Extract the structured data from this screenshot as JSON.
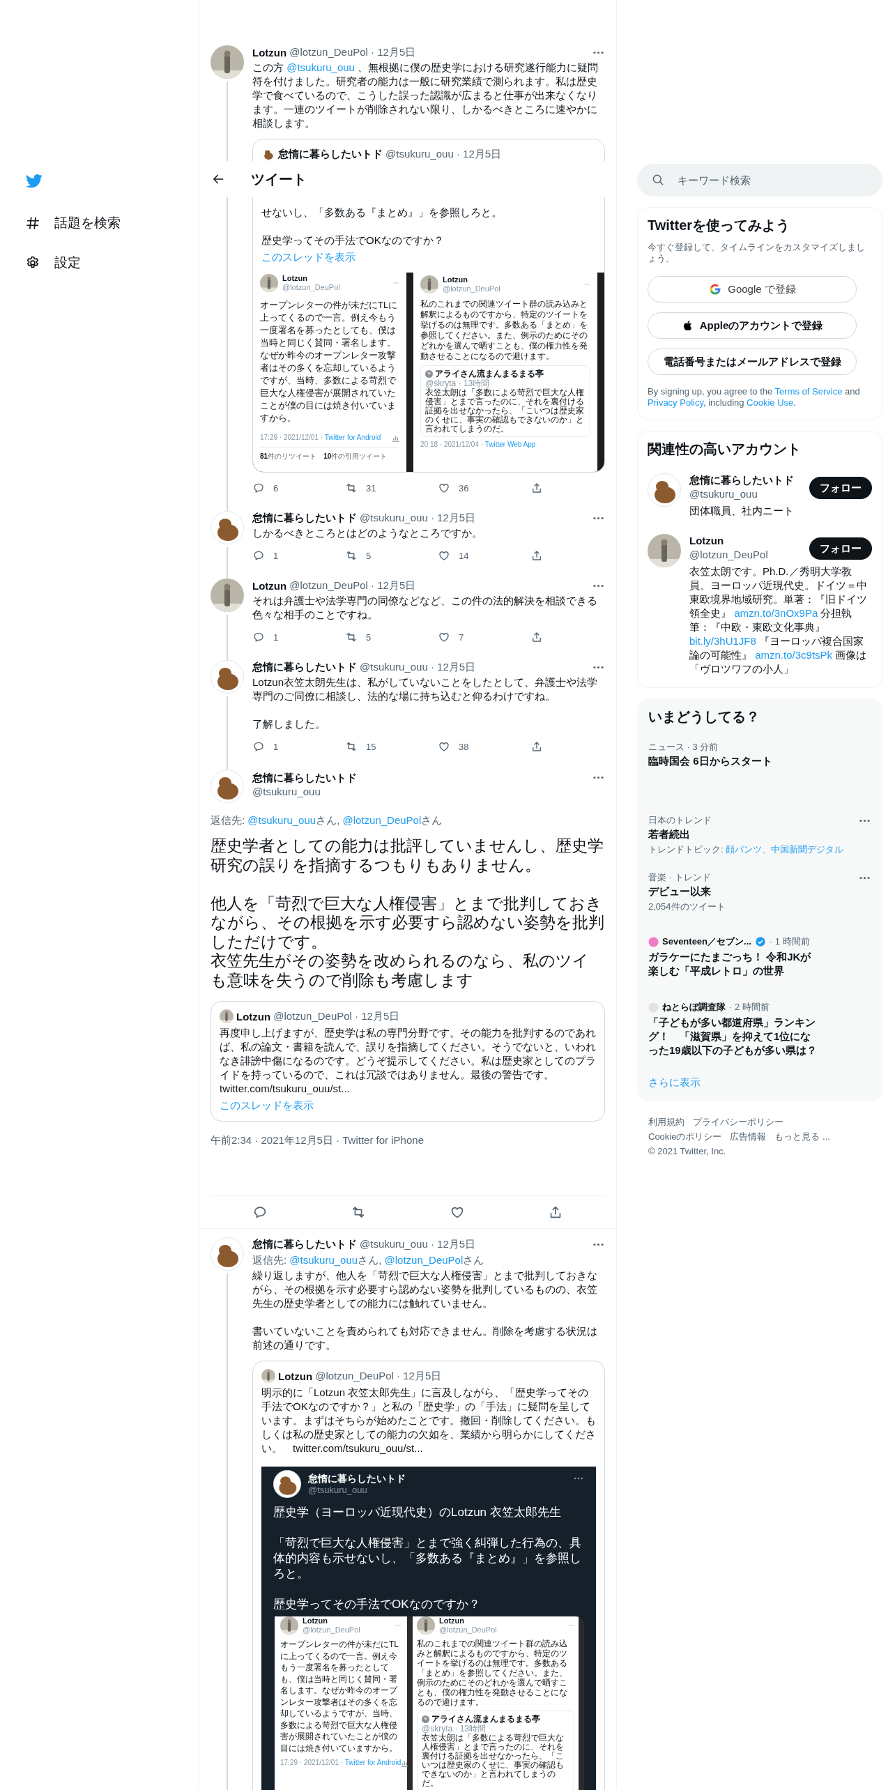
{
  "nav": {
    "items": [
      {
        "kind": "explore",
        "label": "話題を検索"
      },
      {
        "kind": "settings",
        "label": "設定"
      }
    ]
  },
  "header": {
    "title": "ツイート"
  },
  "thread": [
    {
      "avatar": {
        "kind": "statue"
      },
      "name": "Lotzun",
      "meta": "@lotzun_DeuPol · 12月5日",
      "connected": true,
      "text": [
        {
          "kind": "text",
          "t": "この方 "
        },
        {
          "kind": "link",
          "t": "@tsukuru_ouu"
        },
        {
          "kind": "text",
          "t": " 、無根拠に僕の歴史学における研究遂行能力に疑問符を付けました。研究者の能力は一般に研究業績で測られます。私は歴史学で食べているので、こうした誤った認識が広まると仕事が出来なくなります。一連のツイートが削除されない限り、しかるべきところに速やかに相談します。"
        }
      ],
      "quote": {
        "avatar": {
          "kind": "sealion"
        },
        "name": "怠惰に暮らしたいトド",
        "meta": "@tsukuru_ouu · 12月5日",
        "paragraphs": [
          [
            "せないし、「多数ある『まとめ』」を参照しろと。"
          ],
          [
            "歴史学ってその手法でOKなのですか？"
          ]
        ],
        "thread_link": "このスレッドを表示",
        "image": {
          "kind": "panels",
          "panels": [
            {
              "avatar": {
                "kind": "statue"
              },
              "name": "Lotzun",
              "handle": "@lotzun_DeuPol",
              "text": "オープンレターの件が未だにTLに上ってくるので一言。例え今もう一度署名を募ったとしても、僕は当時と同じく賛同・署名します。なぜか昨今のオープンレター攻撃者はその多くを忘却しているようですが、当時、多数による苛烈で巨大な人権侵害が展開されていたことが僕の目には焼き付いていますから。",
              "time": "17:29 · 2021/12/01 · ",
              "app": "Twitter for Android",
              "counts": [
                "**81**件のリツイート",
                "**10**件の引用ツイート"
              ]
            },
            {
              "avatar": {
                "kind": "statue"
              },
              "name": "Lotzun",
              "handle": "@lotzun_DeuPol",
              "text": "私のこれまでの関連ツイート群の読み込みと解釈によるものですから、特定のツイートを挙げるのは無理です。多数ある「まとめ」を参照してください。また、例示のためにそのどれかを選んで晒すことも、僕の権力性を発動させることになるので避けます。",
              "quote": {
                "avatar": {
                  "kind": "plain"
                },
                "name": "アライさん流まんまるまる亭",
                "meta": "@skryta · 13時間",
                "text": "衣笠太朗は「多数による苛烈で巨大な人権侵害」とまで言ったのに、それを裏付ける証拠を出せなかったら、「こいつは歴史家のくせに、事実の確認もできないのか」と言われてしまうのだ。"
              },
              "time": "20:18 · 2021/12/04 · ",
              "app": "Twitter Web App"
            }
          ]
        }
      },
      "stats": {
        "replies": "6",
        "retweets": "31",
        "likes": "36"
      }
    },
    {
      "avatar": {
        "kind": "sealion"
      },
      "name": "怠惰に暮らしたいトド",
      "meta": "@tsukuru_ouu · 12月5日",
      "connected": true,
      "text": "しかるべきところとはどのようなところですか。",
      "stats": {
        "replies": "1",
        "retweets": "5",
        "likes": "14"
      }
    },
    {
      "avatar": {
        "kind": "statue"
      },
      "name": "Lotzun",
      "meta": "@lotzun_DeuPol · 12月5日",
      "connected": true,
      "text": "それは弁護士や法学専門の同僚などなど、この件の法的解決を相談できる色々な相手のことですね。",
      "stats": {
        "replies": "1",
        "retweets": "5",
        "likes": "7"
      }
    },
    {
      "avatar": {
        "kind": "sealion"
      },
      "name": "怠惰に暮らしたいトド",
      "meta": "@tsukuru_ouu · 12月5日",
      "connected": true,
      "paragraphs": [
        [
          "Lotzun衣笠太朗先生は、私がしていないことをしたとして、弁護士や法学専門のご同僚に相談し、法的な場に持ち込むと仰るわけですね。"
        ],
        [
          "了解しました。"
        ]
      ],
      "stats": {
        "replies": "1",
        "retweets": "15",
        "likes": "38"
      }
    }
  ],
  "focus": {
    "avatar": {
      "kind": "sealion"
    },
    "name": "怠惰に暮らしたいトド",
    "handle": "@tsukuru_ouu",
    "reply_to": [
      {
        "kind": "text",
        "t": "返信先: "
      },
      {
        "kind": "link",
        "t": "@tsukuru_ouu"
      },
      {
        "kind": "text",
        "t": "さん, "
      },
      {
        "kind": "link",
        "t": "@lotzun_DeuPol"
      },
      {
        "kind": "text",
        "t": "さん"
      }
    ],
    "paragraphs": [
      [
        "歴史学者としての能力は批評していませんし、歴史学研究の誤りを指摘するつもりもありません。"
      ],
      [
        "他人を「苛烈で巨大な人権侵害」とまで批判しておきながら、その根拠を示す必要すら認めない姿勢を批判しただけです。",
        "衣笠先生がその姿勢を改められるのなら、私のツイも意味を失うので削除も考慮します"
      ]
    ],
    "quote": {
      "avatar": {
        "kind": "statue"
      },
      "name": "Lotzun",
      "meta": "@lotzun_DeuPol · 12月5日",
      "paragraphs": [
        [
          "再度申し上げますが、歴史学は私の専門分野です。その能力を批判するのであれば、私の論文・書籍を読んで、誤りを指摘してください。そうでないと、いわれなき誹謗中傷になるのです。どうぞ提示してください。私は歴史家としてのプライドを持っているので、これは冗談ではありません。最後の警告です。",
          "twitter.com/tsukuru_ouu/st..."
        ]
      ],
      "thread_link": "このスレッドを表示"
    },
    "timestamp": "午前2:34 · 2021年12月5日 · Twitter for iPhone"
  },
  "replies": [
    {
      "avatar": {
        "kind": "sealion"
      },
      "name": "怠惰に暮らしたいトド",
      "meta": "@tsukuru_ouu · 12月5日",
      "connected": true,
      "reply_to": [
        {
          "kind": "text",
          "t": "返信先: "
        },
        {
          "kind": "link",
          "t": "@tsukuru_ouu"
        },
        {
          "kind": "text",
          "t": "さん, "
        },
        {
          "kind": "link",
          "t": "@lotzun_DeuPol"
        },
        {
          "kind": "text",
          "t": "さん"
        }
      ],
      "paragraphs": [
        [
          "繰り返しますが、他人を「苛烈で巨大な人権侵害」とまで批判しておきながら、その根拠を示す必要すら認めない姿勢を批判しているものの、衣笠先生の歴史学者としての能力には触れていません。"
        ],
        [
          "書いていないことを責められても対応できません。削除を考慮する状況は前述の通りです。"
        ]
      ],
      "quote": {
        "avatar": {
          "kind": "statue"
        },
        "name": "Lotzun",
        "meta": "@lotzun_DeuPol · 12月5日",
        "text": "明示的に「Lotzun 衣笠太郎先生」に言及しながら、「歴史学ってその手法でOKなのですか？」と私の「歴史学」の「手法」に疑問を呈しています。まずはそちらが始めたことです。撤回・削除してください。もしくは私の歴史家としての能力の欠如を、業績から明らかにしてください。　twitter.com/tsukuru_ouu/st...",
        "image": {
          "kind": "dark_tweet",
          "avatar": {
            "kind": "sealion"
          },
          "name": "怠惰に暮らしたいトド",
          "handle": "@tsukuru_ouu",
          "paragraphs": [
            [
              "歴史学（ヨーロッパ近現代史）のLotzun 衣笠太郎先生"
            ],
            [
              "「苛烈で巨大な人権侵害」とまで強く糾弾した行為の、具体的内容も示せないし、「多数ある『まとめ』」を参照しろと。"
            ],
            [
              "歴史学ってその手法でOKなのですか？"
            ]
          ],
          "panels": [
            {
              "avatar": {
                "kind": "statue"
              },
              "name": "Lotzun",
              "handle": "@lotzun_DeuPol",
              "text": "オープンレターの件が未だにTLに上ってくるので一言。例え今もう一度署名を募ったとしても、僕は当時と同じく賛同・署名します。なぜか昨今のオープンレター攻撃者はその多くを忘却しているようですが、当時、多数による苛烈で巨大な人権侵害が展開されていたことが僕の目には焼き付いていますから。",
              "time": "17:29 · 2021/12/01 · ",
              "app": "Twitter for Android"
            },
            {
              "avatar": {
                "kind": "statue"
              },
              "name": "Lotzun",
              "handle": "@lotzun_DeuPol",
              "text": "私のこれまでの関連ツイート群の読み込みと解釈によるものですから、特定のツイートを挙げるのは無理です。多数ある「まとめ」を参照してください。また、例示のためにそのどれかを選んで晒すことも、僕の権力性を発動させることになるので避けます。",
              "quote": {
                "avatar": {
                  "kind": "plain"
                },
                "name": "アライさん流まんまるまる亭",
                "meta": "@skryta · 13時間",
                "text": "衣笠太朗は「多数による苛烈で巨大な人権侵害」とまで言ったのに、それを裏付ける証拠を出せなかったら、「こいつは歴史家のくせに、事実の確認もできないのか」と言われてしまうのだ。"
              }
            }
          ]
        }
      }
    }
  ],
  "search": {
    "placeholder": "キーワード検索"
  },
  "signup": {
    "title": "Twitterを使ってみよう",
    "subtitle": "今すぐ登録して、タイムラインをカスタマイズしましょう。",
    "buttons": [
      {
        "kind": "google",
        "label": "Google で登録"
      },
      {
        "kind": "apple",
        "label": "Appleのアカウントで登録"
      },
      {
        "kind": "phone",
        "label": "電話番号またはメールアドレスで登録"
      }
    ],
    "terms": [
      {
        "kind": "text",
        "t": "By signing up, you agree to the "
      },
      {
        "kind": "link",
        "t": "Terms of Service"
      },
      {
        "kind": "text",
        "t": " and "
      },
      {
        "kind": "link",
        "t": "Privacy Policy"
      },
      {
        "kind": "text",
        "t": ", including "
      },
      {
        "kind": "link",
        "t": "Cookie Use"
      },
      {
        "kind": "text",
        "t": "."
      }
    ]
  },
  "who": {
    "title": "関連性の高いアカウント",
    "accounts": [
      {
        "avatar": {
          "kind": "sealion"
        },
        "name": "怠惰に暮らしたいトド",
        "handle": "@tsukuru_ouu",
        "bio": [
          {
            "kind": "text",
            "t": "団体職員、社内ニート"
          }
        ],
        "button": "フォロー"
      },
      {
        "avatar": {
          "kind": "statue"
        },
        "name": "Lotzun",
        "handle": "@lotzun_DeuPol",
        "bio": [
          {
            "kind": "text",
            "t": "衣笠太朗です。Ph.D.／秀明大学教員。ヨーロッパ近現代史。ドイツ＝中東欧境界地域研究。単著：『旧ドイツ領全史』 "
          },
          {
            "kind": "link",
            "t": "amzn.to/3nOx9Pa"
          },
          {
            "kind": "text",
            "t": " 分担執筆：『中欧・東欧文化事典』 "
          },
          {
            "kind": "link",
            "t": "bit.ly/3hU1JF8"
          },
          {
            "kind": "text",
            "t": " 『ヨーロッパ複合国家論の可能性』 "
          },
          {
            "kind": "link",
            "t": "amzn.to/3c9tsPk"
          },
          {
            "kind": "text",
            "t": " 画像は「ヴロツワフの小人」"
          }
        ],
        "button": "フォロー"
      }
    ]
  },
  "trends": {
    "title": "いまどうしてる？",
    "items": [
      {
        "kind": "news",
        "meta": "ニュース · 3 分前",
        "title": "臨時国会 6日からスタート"
      },
      {
        "kind": "trend",
        "meta": "日本のトレンド",
        "title": "若者続出",
        "topics": [
          {
            "kind": "text",
            "t": "トレンドトピック: "
          },
          {
            "kind": "link",
            "t": "顔パンツ"
          },
          {
            "kind": "sep",
            "t": "、"
          },
          {
            "kind": "link",
            "t": "中国新聞デジタル"
          }
        ]
      },
      {
        "kind": "trend",
        "meta": "音楽 · トレンド",
        "title": "デビュー以来",
        "count": "2,054件のツイート"
      },
      {
        "kind": "source_news",
        "source": "Seventeen／セブン...",
        "verified": true,
        "color": "#f07cc3",
        "time": "· 1 時間前",
        "title": "ガラケーにたまごっち！ 令和JKが楽しむ「平成レトロ」の世界"
      },
      {
        "kind": "source_news",
        "source": "ねとらぼ調査隊",
        "verified": false,
        "color": "#e3e3e3",
        "time": "· 2 時間前",
        "title": "「子どもが多い都道府県」ランキング！　「滋賀県」を抑えて1位になった19歳以下の子どもが多い県は？"
      }
    ],
    "more": "さらに表示"
  },
  "footer": {
    "links": [
      "利用規約",
      "プライバシーポリシー",
      "Cookieのポリシー",
      "広告情報",
      "もっと見る ..."
    ],
    "copyright": "© 2021 Twitter, Inc."
  }
}
